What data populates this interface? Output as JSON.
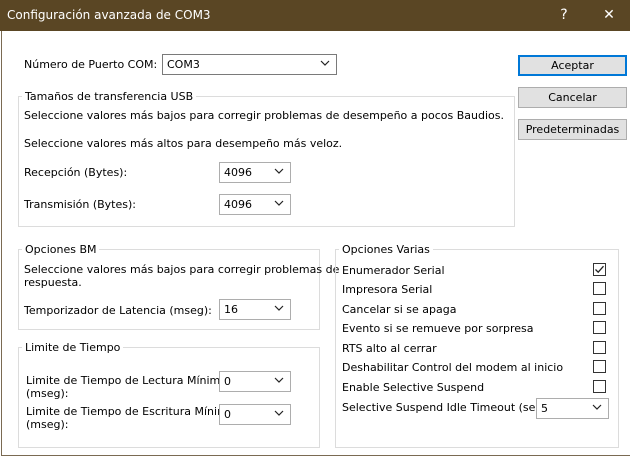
{
  "window": {
    "title": "Configuración avanzada de COM3",
    "help": "?",
    "close": "✕"
  },
  "com_port": {
    "label": "Número de Puerto COM:",
    "value": "COM3"
  },
  "buttons": {
    "accept": "Aceptar",
    "cancel": "Cancelar",
    "defaults": "Predeterminadas"
  },
  "usb": {
    "title": "Tamaños de transferencia USB",
    "hint_low": "Seleccione valores más bajos para corregir problemas de desempeño a pocos Baudios.",
    "hint_high": "Seleccione valores más altos para desempeño más veloz.",
    "rx_label": "Recepción (Bytes):",
    "rx_value": "4096",
    "tx_label": "Transmisión (Bytes):",
    "tx_value": "4096"
  },
  "bm": {
    "title": "Opciones BM",
    "hint_line1": "Seleccione valores más bajos para corregir problemas de",
    "hint_line2": "respuesta.",
    "latency_label": "Temporizador de Latencia (mseg):",
    "latency_value": "16"
  },
  "timeouts": {
    "title": "Limite de Tiempo",
    "read_line1": "Limite de Tiempo de Lectura Mínimo",
    "read_line2": "(mseg):",
    "read_value": "0",
    "write_line1": "Limite de Tiempo de Escritura Mínimo",
    "write_line2": "(mseg):",
    "write_value": "0"
  },
  "misc": {
    "title": "Opciones Varias",
    "options": [
      {
        "label": "Enumerador Serial",
        "checked": true
      },
      {
        "label": "Impresora Serial",
        "checked": false
      },
      {
        "label": "Cancelar si se apaga",
        "checked": false
      },
      {
        "label": "Evento si se remueve por sorpresa",
        "checked": false
      },
      {
        "label": "RTS alto al cerrar",
        "checked": false
      },
      {
        "label": "Deshabilitar Control del modem al inicio",
        "checked": false
      },
      {
        "label": "Enable Selective Suspend",
        "checked": false
      }
    ],
    "suspend_label": "Selective Suspend Idle Timeout (secs):",
    "suspend_value": "5"
  }
}
